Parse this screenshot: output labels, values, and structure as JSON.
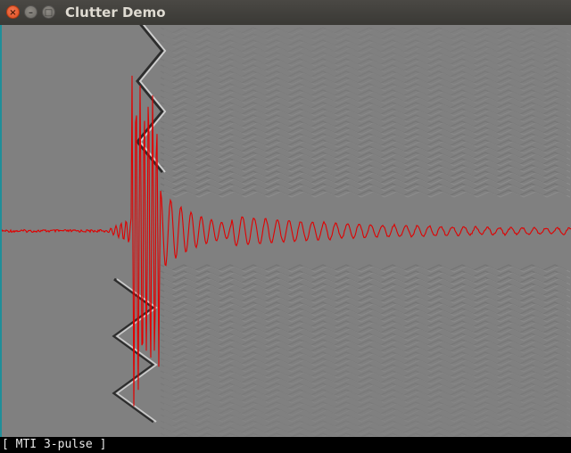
{
  "window": {
    "title": "Clutter Demo",
    "close_glyph": "×",
    "minimize_glyph": "–",
    "maximize_glyph": "□"
  },
  "status": {
    "text": "[ MTI 3-pulse ]"
  },
  "colors": {
    "background_gray": "#808080",
    "trace": "#e00000",
    "titlebar": "#3d3c38"
  }
}
